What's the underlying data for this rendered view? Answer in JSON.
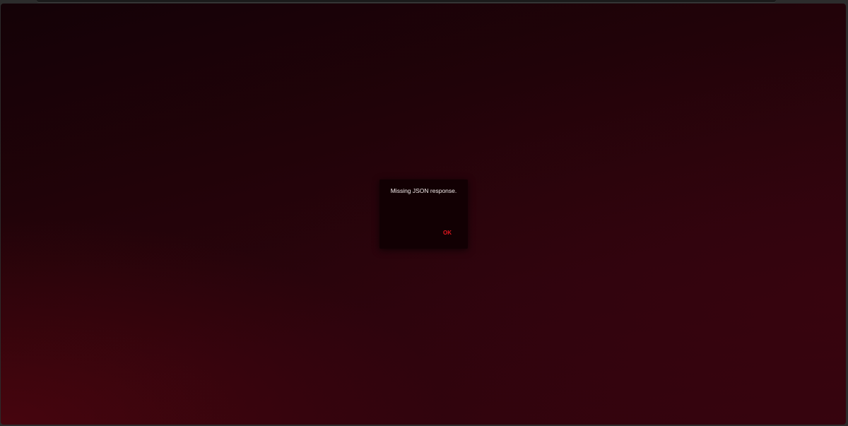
{
  "dialog": {
    "message": "Missing JSON response.",
    "ok_label": "OK"
  },
  "colors": {
    "accent": "#e0161f",
    "dialog_bg": "#120003",
    "background_dark": "#140207",
    "background_red": "#3a050f"
  }
}
